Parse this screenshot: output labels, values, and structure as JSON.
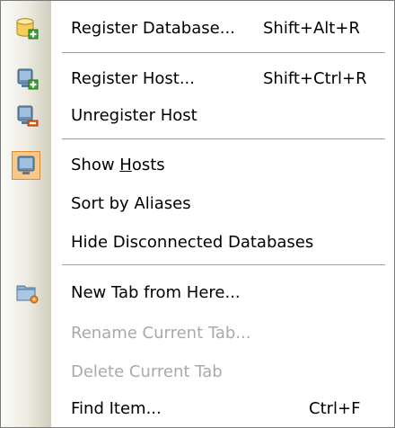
{
  "menu": {
    "items": [
      {
        "label": "Register Database...",
        "shortcut": "Shift+Alt+R",
        "icon": "database-add-icon",
        "enabled": true
      },
      {
        "label": "Register Host...",
        "shortcut": "Shift+Ctrl+R",
        "icon": "host-add-icon",
        "enabled": true
      },
      {
        "label": "Unregister Host",
        "shortcut": "",
        "icon": "host-remove-icon",
        "enabled": true
      },
      {
        "label_pre": "Show ",
        "label_accel": "H",
        "label_post": "osts",
        "shortcut": "",
        "icon": "host-icon",
        "checked": true,
        "enabled": true
      },
      {
        "label": "Sort by Aliases",
        "shortcut": "",
        "icon": "",
        "enabled": true
      },
      {
        "label": "Hide Disconnected Databases",
        "shortcut": "",
        "icon": "",
        "enabled": true
      },
      {
        "label": "New Tab from Here...",
        "shortcut": "",
        "icon": "folder-new-tab-icon",
        "enabled": true
      },
      {
        "label": "Rename Current Tab...",
        "shortcut": "",
        "icon": "",
        "enabled": false
      },
      {
        "label": "Delete Current Tab",
        "shortcut": "",
        "icon": "",
        "enabled": false
      },
      {
        "label": "Find Item...",
        "shortcut": "Ctrl+F",
        "icon": "",
        "enabled": true
      }
    ]
  }
}
